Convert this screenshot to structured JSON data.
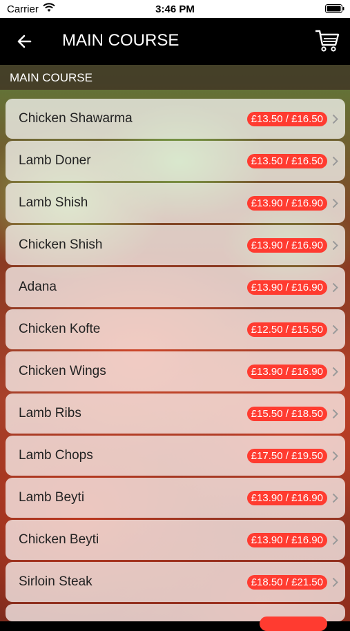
{
  "status_bar": {
    "carrier": "Carrier",
    "time": "3:46 PM"
  },
  "nav": {
    "title": "MAIN COURSE"
  },
  "section": {
    "title": "MAIN COURSE"
  },
  "items": [
    {
      "name": "Chicken Shawarma",
      "price": "£13.50 / £16.50"
    },
    {
      "name": "Lamb Doner",
      "price": "£13.50 / £16.50"
    },
    {
      "name": "Lamb Shish",
      "price": "£13.90 / £16.90"
    },
    {
      "name": "Chicken Shish",
      "price": "£13.90 / £16.90"
    },
    {
      "name": "Adana",
      "price": "£13.90 / £16.90"
    },
    {
      "name": "Chicken Kofte",
      "price": "£12.50 / £15.50"
    },
    {
      "name": "Chicken Wings",
      "price": "£13.90 / £16.90"
    },
    {
      "name": "Lamb Ribs",
      "price": "£15.50 / £18.50"
    },
    {
      "name": "Lamb Chops",
      "price": "£17.50 / £19.50"
    },
    {
      "name": "Lamb Beyti",
      "price": "£13.90 / £16.90"
    },
    {
      "name": "Chicken Beyti",
      "price": "£13.90 / £16.90"
    },
    {
      "name": "Sirloin Steak",
      "price": "£18.50 / £21.50"
    },
    {
      "name": "",
      "price": ""
    }
  ],
  "colors": {
    "badge": "#ff3b30",
    "nav_background": "#000000"
  },
  "icons": {
    "back": "arrow-left-icon",
    "cart": "cart-icon",
    "row": "chevron-right-icon"
  }
}
